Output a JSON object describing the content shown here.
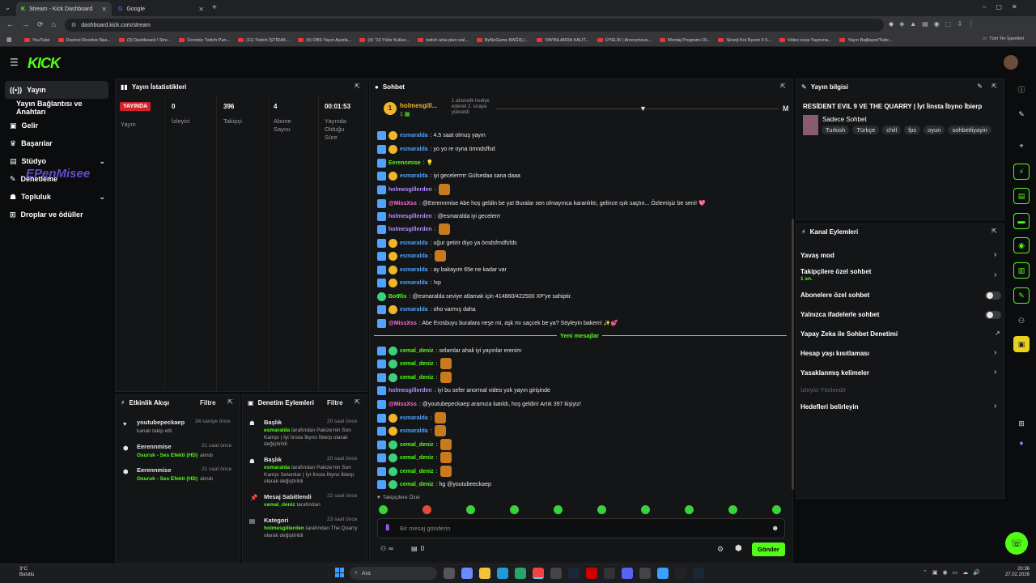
{
  "browser": {
    "tabs": [
      "Stream - Kick Dashboard",
      "Google"
    ],
    "url": "dashboard.kick.com/stream",
    "bookmarks": [
      "YouTube",
      "Davinci Resolve Nas...",
      "(3) Dashboard / Stre...",
      "Ücretsiz Twitch Pan...",
      "(11) Twitch İŞTİRAK...",
      "(4) OBS Yayın Ayarla...",
      "(4) \"10 Yıldır Kullan...",
      "twitch arka plan wal...",
      "ByNoGame BAĞIŞ |...",
      "YAYINLARDA KALIT...",
      "ÜYELİK | Anonymous...",
      "Montaj Programı Ol...",
      "Sinerji Koi Ryzen 5 5...",
      "Video veya Yayınına...",
      "Yayın Bağlayor/Twitc..."
    ],
    "all_bookmarks": "Tüm Yer İşaretleri"
  },
  "app": {
    "logo": "KICK"
  },
  "sidebar": {
    "items": [
      "Yayın",
      "Yayın Bağlantısı ve Anahtarı",
      "Gelir",
      "Başarılar",
      "Stüdyo",
      "Denetleme",
      "Topluluk",
      "Droplar ve ödüller"
    ],
    "overlay": "EPenMisee"
  },
  "stats": {
    "title": "Yayın İstatistikleri",
    "live": "YAYINDA",
    "live_label": "Yayın",
    "cols": [
      {
        "value": "0",
        "label": "İzleyici"
      },
      {
        "value": "396",
        "label": "Takipçi"
      },
      {
        "value": "4",
        "label": "Abone Sayısı"
      },
      {
        "value": "00:01:53",
        "label": "Yayında Olduğu Süre"
      }
    ]
  },
  "activity": {
    "title": "Etkinlik Akışı",
    "filter": "Filtre",
    "items": [
      {
        "user": "youtubepeckaep",
        "desc": "kanalı takip etti",
        "time": "34 saniye önce"
      },
      {
        "user": "Eerennmise",
        "desc": "Osuruk - Ses Efekti (HD)",
        "suffix": "alındı",
        "time": "21 saat önce"
      },
      {
        "user": "Eerennmise",
        "desc": "Osuruk - Ses Efekti (HD)",
        "suffix": "alındı",
        "time": "21 saat önce"
      }
    ]
  },
  "moderation": {
    "title": "Denetim Eylemleri",
    "filter": "Filtre",
    "items": [
      {
        "type": "Başlık",
        "time": "20 saat önce",
        "user": "esmaralda",
        "text": "tarafından Pakize'nin Son Kampı | İyt İinsta İbyno İbierp olarak değiştirildi"
      },
      {
        "type": "Başlık",
        "time": "20 saat önce",
        "user": "esmaralda",
        "text": "tarafından Pakize'nin Son Kampı Selamlar | İyt İinsta İbyno İbierp olarak değiştirildi"
      },
      {
        "type": "Mesaj Sabitlendi",
        "time": "22 saat önce",
        "user": "cemal_deniz",
        "text": "tarafından"
      },
      {
        "type": "Kategori",
        "time": "23 saat önce",
        "user": "holmesgillerden",
        "text": "tarafından The Quarry olarak değiştirildi"
      }
    ]
  },
  "chat": {
    "title": "Sohbet",
    "pinned_user": "holmesgill...",
    "pinned_note": "1 abonelik hediye ederek 2. sıraya yükseldi",
    "pinned_count": "1",
    "new_messages": "Yeni mesajlar",
    "followers_only": "Takipçilere Özel",
    "placeholder": "Bir mesaj gönderin",
    "send": "Gönder",
    "viewers": "∞",
    "count": "0",
    "messages": [
      {
        "user": "esmaralda",
        "text": ": 4.5 saat olmuş yayın",
        "color": "#4fa3ff"
      },
      {
        "user": "esmaralda",
        "text": ": yo yo re oyna ömndsffsd",
        "color": "#4fa3ff"
      },
      {
        "user": "Eerennmise",
        "text": ": 💡",
        "color": "#53fc18"
      },
      {
        "user": "esmaralda",
        "text": ": iyi gecelerrrrr Gülsedaa sana daaa",
        "color": "#4fa3ff"
      },
      {
        "user": "holmesgillerden",
        "text": ":",
        "color": "#b48cff"
      },
      {
        "user": "@MissXss",
        "text": ": @Eerennmise Abe hoş geldin be ya! Buralar sen olmayınca karanlıktı, gelince ışık saçtın... Özlemişiz be seni! 💖",
        "color": "#ff6ad5"
      },
      {
        "user": "holmesgillerden",
        "text": ": @esmaralda iyi gecelerrr",
        "color": "#b48cff"
      },
      {
        "user": "holmesgillerden",
        "text": ":",
        "color": "#b48cff"
      },
      {
        "user": "esmaralda",
        "text": ": uğur getirir diyo ya ömdsfmdfsfds",
        "color": "#4fa3ff"
      },
      {
        "user": "esmaralda",
        "text": ":",
        "color": "#4fa3ff"
      },
      {
        "user": "esmaralda",
        "text": ": ay bakayım 65e ne kadar var",
        "color": "#4fa3ff"
      },
      {
        "user": "esmaralda",
        "text": ": !xp",
        "color": "#4fa3ff"
      },
      {
        "user": "BotRix",
        "text": ": @esmaralda seviye atlamak için 414860/422500 XP'ye sahiptir.",
        "color": "#53fc18"
      },
      {
        "user": "esmaralda",
        "text": ": oho varmış daha",
        "color": "#4fa3ff"
      },
      {
        "user": "@MissXss",
        "text": ": Abe Erosbuyu buralara neşe mi, aşk mı saçcek be ya? Söyleyin bakem! ✨💕",
        "color": "#ff6ad5"
      },
      {
        "user": "cemal_deniz",
        "text": ": selamlar ahali iyi yayınlar erenim",
        "color": "#53fc18"
      },
      {
        "user": "cemal_deniz",
        "text": ":",
        "color": "#53fc18"
      },
      {
        "user": "cemal_deniz",
        "text": ":",
        "color": "#53fc18"
      },
      {
        "user": "holmesgillerden",
        "text": ": iyi bu sefer anormal video yok yayın girişinde",
        "color": "#b48cff"
      },
      {
        "user": "@MissXss",
        "text": ": @youtubepeckaep aramıza katıldı, hoş geldin! Artık 397 kişiyiz!",
        "color": "#ff6ad5"
      },
      {
        "user": "esmaralda",
        "text": ":",
        "color": "#4fa3ff"
      },
      {
        "user": "esmaralda",
        "text": ":",
        "color": "#4fa3ff"
      },
      {
        "user": "cemal_deniz",
        "text": ":",
        "color": "#53fc18"
      },
      {
        "user": "cemal_deniz",
        "text": ":",
        "color": "#53fc18"
      },
      {
        "user": "cemal_deniz",
        "text": ":",
        "color": "#53fc18"
      },
      {
        "user": "cemal_deniz",
        "text": ": hg @youtubeeckaep",
        "color": "#53fc18"
      }
    ]
  },
  "info": {
    "title": "Yayın bilgisi",
    "stream_title": "RESİDENT EVIL 9 VE THE QUARRY | İyt İinsta İbyno İbierp",
    "category": "Sadece Sohbet",
    "tags": [
      "Turkish",
      "Türkçe",
      "chill",
      "fps",
      "oyun",
      "sohbetliyayin"
    ]
  },
  "actions": {
    "title": "Kanal Eylemleri",
    "items": [
      "Yavaş mod",
      "Takipçilere özel sohbet",
      "Abonelere özel sohbet",
      "Yalnızca ifadelerle sohbet",
      "Yapay Zeka ile Sohbet Denetimi",
      "Hesap yaşı kısıtlaması",
      "Yasaklanmış kelimeler",
      "İzleyici Yönlendir",
      "Hedefleri belirleyin"
    ],
    "follower_sub": "1 sn."
  },
  "taskbar": {
    "weather": "3°C",
    "weather_desc": "Bulutlu",
    "search": "Ara",
    "time": "20:36",
    "date": "27.02.2026"
  }
}
